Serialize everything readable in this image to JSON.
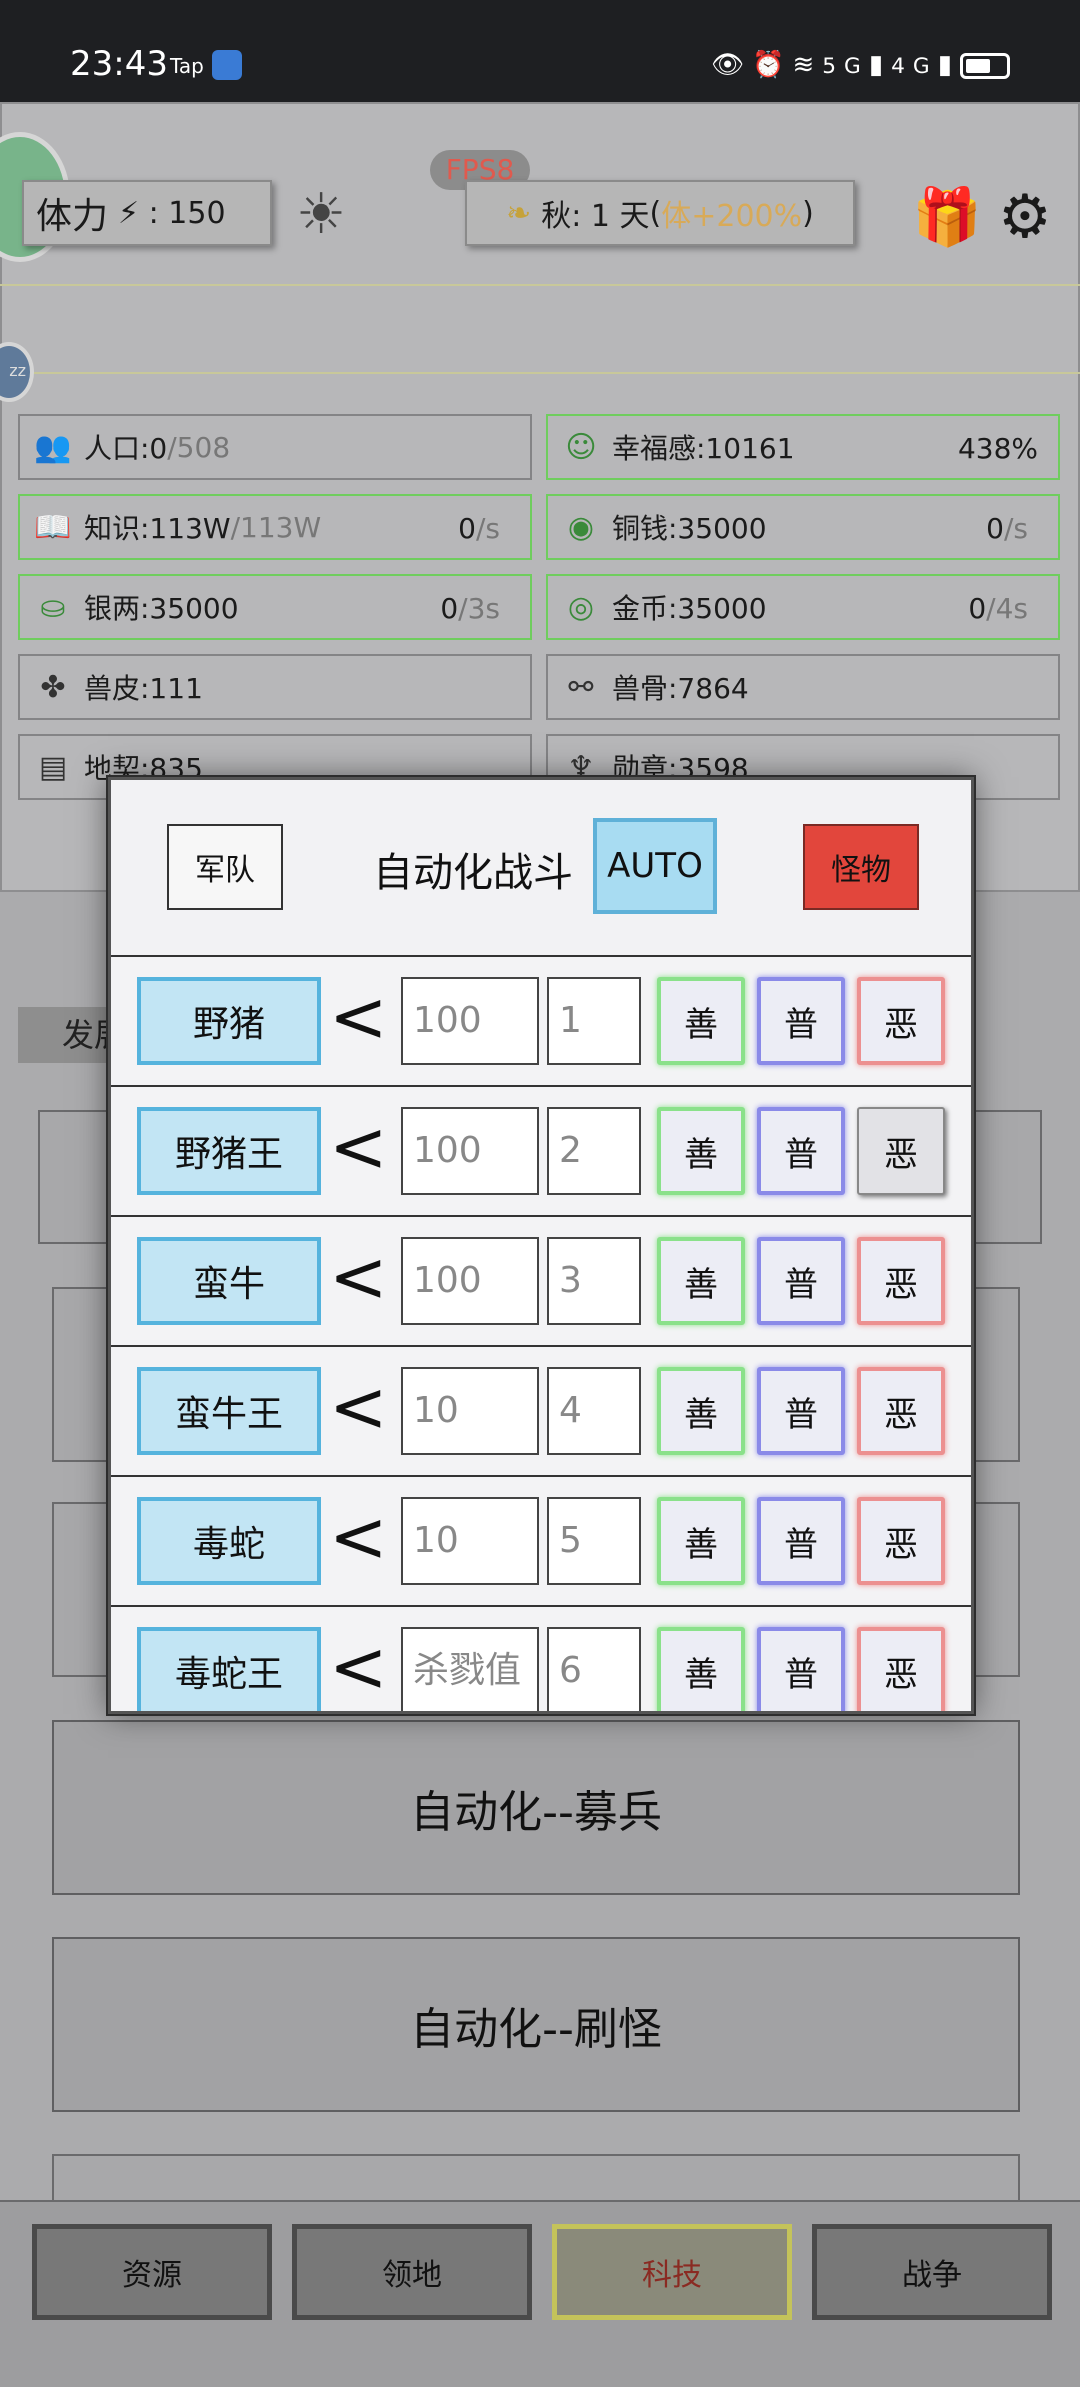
{
  "status_bar": {
    "time": "23:43",
    "app_label": "Tap",
    "icons": [
      "eye-icon",
      "alarm-icon",
      "wifi-icon",
      "signal-5g-icon",
      "signal-4g-icon",
      "battery-icon"
    ],
    "net1": "5G",
    "net2": "4G"
  },
  "header": {
    "stamina_label": "体力",
    "stamina_sep": "⚡ :",
    "stamina_value": "150",
    "fps": "FPS8",
    "season_text": "秋: 1 天",
    "season_bonus_open": " (",
    "season_bonus": "体+200%",
    "season_bonus_close": ")"
  },
  "resources": {
    "population": {
      "label": "人口:0",
      "max": "/508"
    },
    "happiness": {
      "label": "幸福感:10161",
      "pct": "438%"
    },
    "knowledge": {
      "label": "知识:113W",
      "max": "/113W",
      "rate": "0",
      "unit": "/s"
    },
    "copper": {
      "label": "铜钱:35000",
      "rate": "0",
      "unit": "/s"
    },
    "silver": {
      "label": "银两:35000",
      "rate": "0",
      "unit": "/3s"
    },
    "gold": {
      "label": "金币:35000",
      "rate": "0",
      "unit": "/4s"
    },
    "hide": {
      "label": "兽皮:111"
    },
    "bone": {
      "label": "兽骨:7864"
    },
    "deed": {
      "label": "地契:835"
    },
    "medal": {
      "label": "勋章:3598"
    }
  },
  "background": {
    "faded_tab": "发展",
    "auto_recruit": "自动化--募兵",
    "auto_farm": "自动化--刷怪"
  },
  "modal": {
    "army_button": "军队",
    "title": "自动化战斗",
    "auto_button": "AUTO",
    "monster_button": "怪物",
    "rows": [
      {
        "name": "野猪",
        "op": "<",
        "threshold": "100",
        "order": "1",
        "good": "善",
        "normal": "普",
        "evil": "恶"
      },
      {
        "name": "野猪王",
        "op": "<",
        "threshold": "100",
        "order": "2",
        "good": "善",
        "normal": "普",
        "evil": "恶"
      },
      {
        "name": "蛮牛",
        "op": "<",
        "threshold": "100",
        "order": "3",
        "good": "善",
        "normal": "普",
        "evil": "恶"
      },
      {
        "name": "蛮牛王",
        "op": "<",
        "threshold": "10",
        "order": "4",
        "good": "善",
        "normal": "普",
        "evil": "恶"
      },
      {
        "name": "毒蛇",
        "op": "<",
        "threshold": "10",
        "order": "5",
        "good": "善",
        "normal": "普",
        "evil": "恶"
      },
      {
        "name": "毒蛇王",
        "op": "<",
        "threshold": "",
        "threshold_placeholder": "杀戮值",
        "order": "6",
        "good": "善",
        "normal": "普",
        "evil": "恶"
      }
    ]
  },
  "bottom_nav": {
    "resources": "资源",
    "territory": "领地",
    "tech": "科技",
    "war": "战争"
  }
}
